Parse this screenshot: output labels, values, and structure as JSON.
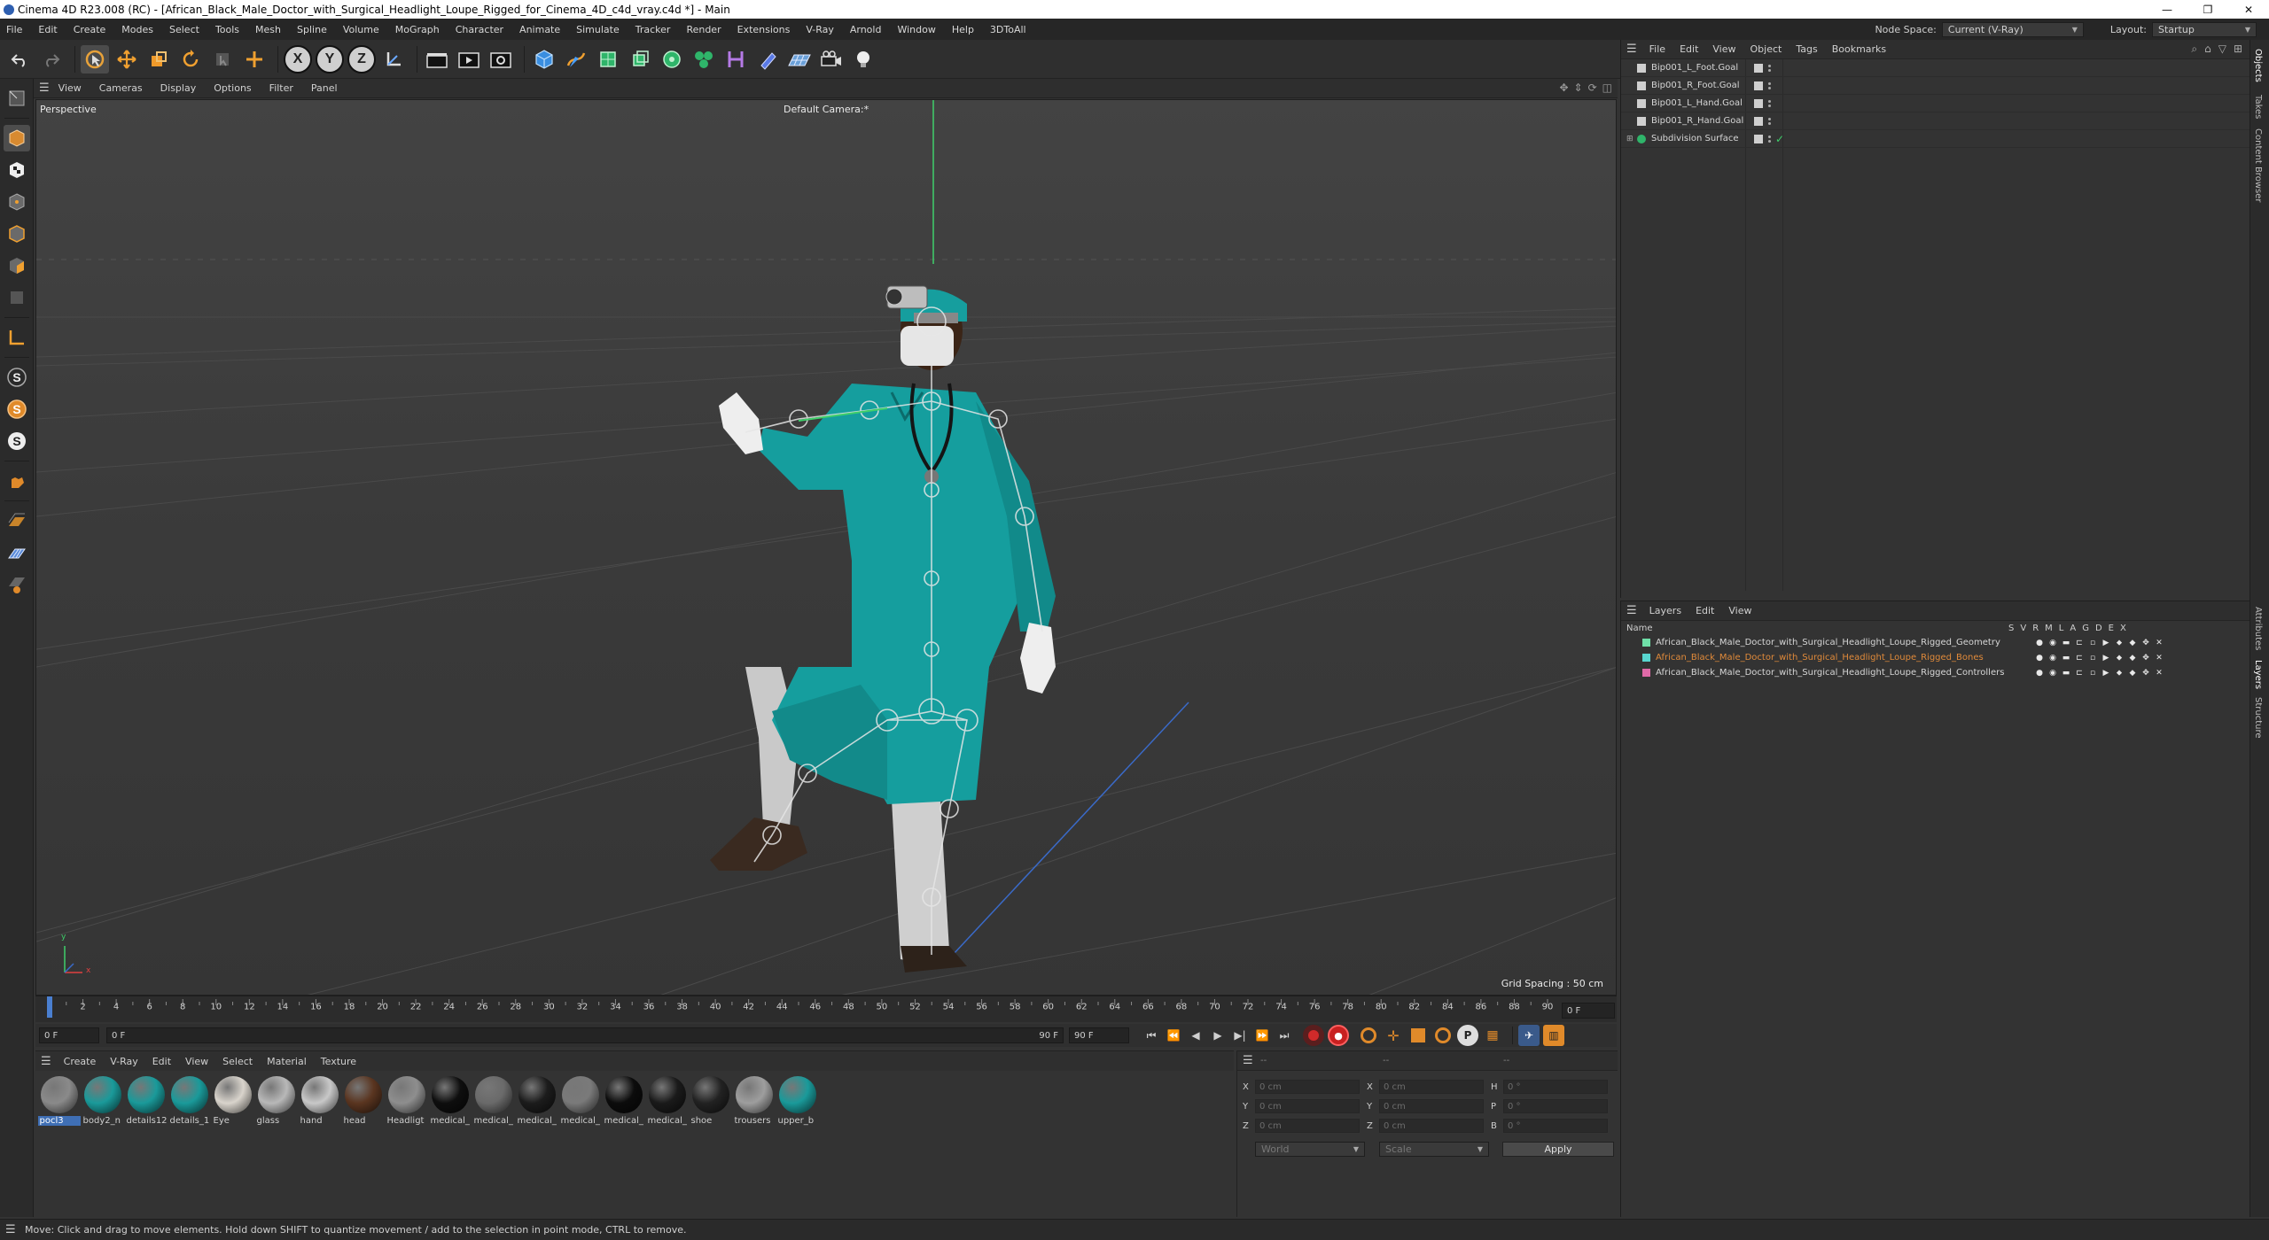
{
  "window": {
    "title": "Cinema 4D R23.008 (RC) - [African_Black_Male_Doctor_with_Surgical_Headlight_Loupe_Rigged_for_Cinema_4D_c4d_vray.c4d *] - Main",
    "controls": [
      "—",
      "❐",
      "✕"
    ]
  },
  "menubar": {
    "items": [
      "File",
      "Edit",
      "Create",
      "Modes",
      "Select",
      "Tools",
      "Mesh",
      "Spline",
      "Volume",
      "MoGraph",
      "Character",
      "Animate",
      "Simulate",
      "Tracker",
      "Render",
      "Extensions",
      "V-Ray",
      "Arnold",
      "Window",
      "Help",
      "3DToAll"
    ],
    "node_space_label": "Node Space:",
    "node_space_value": "Current (V-Ray)",
    "layout_label": "Layout:",
    "layout_value": "Startup"
  },
  "toolbar": {
    "axis_buttons": [
      "X",
      "Y",
      "Z"
    ]
  },
  "viewport": {
    "menu": [
      "View",
      "Cameras",
      "Display",
      "Options",
      "Filter",
      "Panel"
    ],
    "projection": "Perspective",
    "camera": "Default Camera",
    "camera_suffix": ":*",
    "grid_spacing": "Grid Spacing : 50 cm",
    "axis_y": "y",
    "axis_x": "x",
    "axis_z": "z"
  },
  "timeline": {
    "ticks": [
      "0",
      "2",
      "4",
      "6",
      "8",
      "10",
      "12",
      "14",
      "16",
      "18",
      "20",
      "22",
      "24",
      "26",
      "28",
      "30",
      "32",
      "34",
      "36",
      "38",
      "40",
      "42",
      "44",
      "46",
      "48",
      "50",
      "52",
      "54",
      "56",
      "58",
      "60",
      "62",
      "64",
      "66",
      "68",
      "70",
      "72",
      "74",
      "76",
      "78",
      "80",
      "82",
      "84",
      "86",
      "88",
      "90"
    ],
    "current_frame_field": "0 F",
    "start_field": "0 F",
    "range_start": "0 F",
    "range_end": "90 F",
    "end_field": "90 F"
  },
  "materials": {
    "menu": [
      "Create",
      "V-Ray",
      "Edit",
      "View",
      "Select",
      "Material",
      "Texture"
    ],
    "items": [
      {
        "name": "pocl3",
        "color": "#8a8a8a",
        "selected": true
      },
      {
        "name": "body2_n",
        "color": "#1a9a9a"
      },
      {
        "name": "details12",
        "color": "#1a9a9a"
      },
      {
        "name": "details_1",
        "color": "#1a9a9a"
      },
      {
        "name": "Eye",
        "color": "#d9d4cc"
      },
      {
        "name": "glass",
        "color": "#b8b8b8"
      },
      {
        "name": "hand",
        "color": "#c8c8c8"
      },
      {
        "name": "head",
        "color": "#5a3520"
      },
      {
        "name": "Headligt",
        "color": "#8e8e8e"
      },
      {
        "name": "medical_",
        "color": "#0e0e0e"
      },
      {
        "name": "medical_",
        "color": "#6a6a6a"
      },
      {
        "name": "medical_",
        "color": "#1c1c1c"
      },
      {
        "name": "medical_",
        "color": "#7a7a7a"
      },
      {
        "name": "medical_",
        "color": "#0c0c0c"
      },
      {
        "name": "medical_",
        "color": "#1a1a1a"
      },
      {
        "name": "shoe",
        "color": "#222222"
      },
      {
        "name": "trousers",
        "color": "#9e9e9e"
      },
      {
        "name": "upper_b",
        "color": "#1a9a9a"
      }
    ]
  },
  "coordinates": {
    "header_cols": [
      "--",
      "--",
      "--"
    ],
    "rows": [
      {
        "a": "X",
        "av": "0 cm",
        "b": "X",
        "bv": "0 cm",
        "c": "H",
        "cv": "0 °"
      },
      {
        "a": "Y",
        "av": "0 cm",
        "b": "Y",
        "bv": "0 cm",
        "c": "P",
        "cv": "0 °"
      },
      {
        "a": "Z",
        "av": "0 cm",
        "b": "Z",
        "bv": "0 cm",
        "c": "B",
        "cv": "0 °"
      }
    ],
    "mode1": "World",
    "mode2": "Scale",
    "apply": "Apply"
  },
  "objects": {
    "menu": [
      "File",
      "Edit",
      "View",
      "Object",
      "Tags",
      "Bookmarks"
    ],
    "items": [
      {
        "name": "Bip001_L_Foot.Goal"
      },
      {
        "name": "Bip001_R_Foot.Goal"
      },
      {
        "name": "Bip001_L_Hand.Goal"
      },
      {
        "name": "Bip001_R_Hand.Goal"
      },
      {
        "name": "Subdivision Surface"
      }
    ]
  },
  "layers": {
    "menu": [
      "Layers",
      "Edit",
      "View"
    ],
    "name_header": "Name",
    "flag_headers": [
      "S",
      "V",
      "R",
      "M",
      "L",
      "A",
      "G",
      "D",
      "E",
      "X"
    ],
    "items": [
      {
        "name": "African_Black_Male_Doctor_with_Surgical_Headlight_Loupe_Rigged_Geometry",
        "color": "#6fe0a8",
        "highlight": false
      },
      {
        "name": "African_Black_Male_Doctor_with_Surgical_Headlight_Loupe_Rigged_Bones",
        "color": "#58d6d0",
        "highlight": true
      },
      {
        "name": "African_Black_Male_Doctor_with_Surgical_Headlight_Loupe_Rigged_Controllers",
        "color": "#e06aa8",
        "highlight": false
      }
    ]
  },
  "side_tabs": [
    "Objects",
    "Takes",
    "Content Browser",
    "Attributes",
    "Layers",
    "Structure"
  ],
  "status": "Move: Click and drag to move elements. Hold down SHIFT to quantize movement / add to the selection in point mode, CTRL to remove.",
  "colors": {
    "accent": "#3f6fb5",
    "scrubs": "#18a0a0",
    "bones_text": "#e08a3a"
  }
}
